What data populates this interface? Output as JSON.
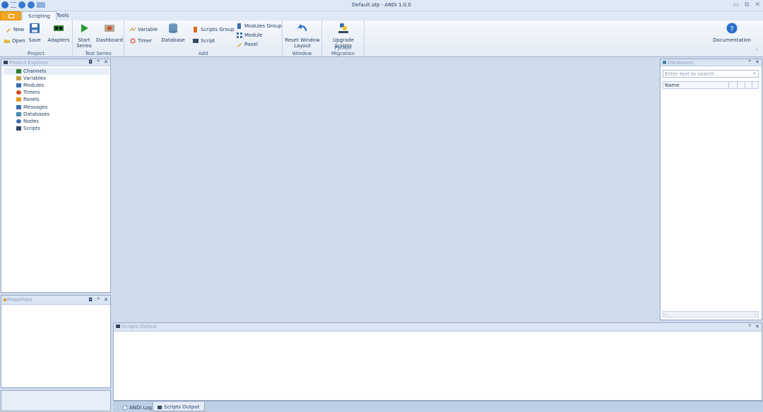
{
  "window": {
    "title": "Default.atp - ANDi 1.0.0"
  },
  "tabs": [
    {
      "label": "Scripting",
      "active": true
    },
    {
      "label": "Tools",
      "active": false
    }
  ],
  "ribbon": {
    "project": {
      "label": "Project",
      "new": "New",
      "open": "Open",
      "save": "Save",
      "adapters": "Adapters"
    },
    "test_series": {
      "label": "Test Series",
      "start_line1": "Start",
      "start_line2": "Series",
      "dashboard": "Dashboard"
    },
    "add": {
      "label": "Add",
      "variable": "Variable",
      "timer": "Timer",
      "database": "Database",
      "scripts_group": "Scripts Group",
      "script": "Script",
      "modules_group": "Modules Group",
      "module": "Module",
      "panel": "Panel"
    },
    "window_group": {
      "label": "Window",
      "reset_line1": "Reset Window",
      "reset_line2": "Layout"
    },
    "python": {
      "label": "Python Migration",
      "upgrade_line1": "Upgrade",
      "upgrade_line2": "Scripts"
    },
    "help": {
      "documentation": "Documentation"
    }
  },
  "project_explorer": {
    "title": "Project Explorer",
    "items": [
      {
        "label": "Channels",
        "icon": "channels-icon",
        "color": "#2e7d32"
      },
      {
        "label": "Variables",
        "icon": "variables-icon",
        "color": "#c8a040"
      },
      {
        "label": "Modules",
        "icon": "modules-icon",
        "color": "#3a6fb0"
      },
      {
        "label": "Timers",
        "icon": "timers-icon",
        "color": "#d04a2a"
      },
      {
        "label": "Panels",
        "icon": "panels-icon",
        "color": "#e89a1a"
      },
      {
        "label": "Messages",
        "icon": "messages-icon",
        "color": "#3a6fb0"
      },
      {
        "label": "Databases",
        "icon": "databases-icon",
        "color": "#4a8ab0"
      },
      {
        "label": "Nodes",
        "icon": "nodes-icon",
        "color": "#3a6fb0"
      },
      {
        "label": "Scripts",
        "icon": "scripts-icon",
        "color": "#33475f"
      }
    ]
  },
  "properties": {
    "title": "Properties"
  },
  "databases_panel": {
    "title": "Databases",
    "search_placeholder": "Enter text to search...",
    "column_name": "Name"
  },
  "scripts_output": {
    "title": "Scripts Output"
  },
  "bottom_tabs": [
    {
      "label": "ANDi Log",
      "active": false
    },
    {
      "label": "Scripts Output",
      "active": true
    }
  ],
  "colors": {
    "accent": "#f5a623",
    "workspace": "#cfdcec"
  }
}
